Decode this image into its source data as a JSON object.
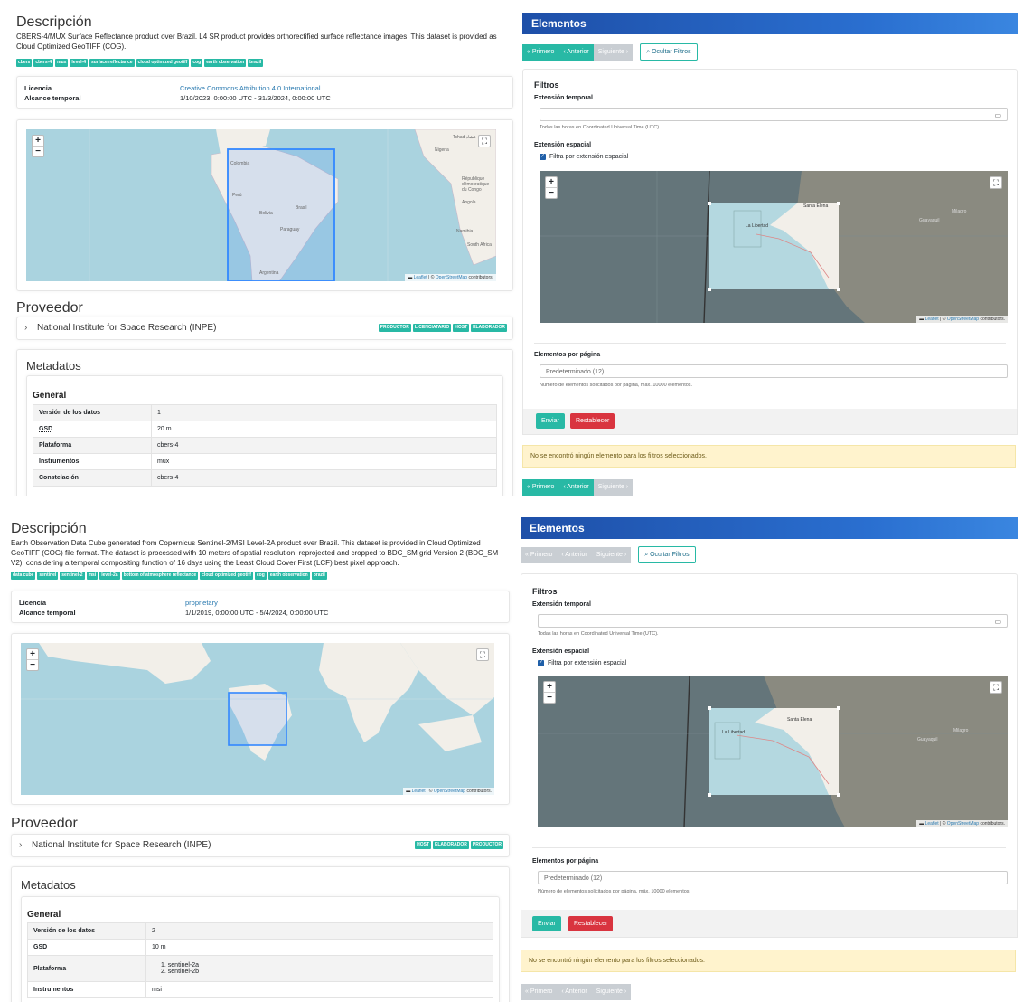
{
  "panel1": {
    "description": {
      "title": "Descripción",
      "text": "CBERS-4/MUX Surface Reflectance product over Brazil. L4 SR product provides orthorectified surface reflectance images. This dataset is provided as Cloud Optimized GeoTIFF (COG).",
      "keywords": [
        "cbers",
        "cbers-4",
        "mux",
        "level-4",
        "surface reflectance",
        "cloud optimized geotiff",
        "cog",
        "earth observation",
        "brazil"
      ]
    },
    "license_label": "Licencia",
    "license_value": "Creative Commons Attribution 4.0 International",
    "temporal_label": "Alcance temporal",
    "temporal_value": "1/10/2023, 0:00:00 UTC - 31/3/2024, 0:00:00 UTC",
    "map_attribution_leaflet": "Leaflet",
    "map_attribution_osm": "OpenStreetMap",
    "map_attribution_rest": "contributors.",
    "provider_title": "Proveedor",
    "provider_name": "National Institute for Space Research (INPE)",
    "provider_roles": [
      "PRODUCTOR",
      "LICENCIATARIO",
      "HOST",
      "ELABORADOR"
    ],
    "metadata_title": "Metadatos",
    "general_title": "General",
    "metadata_rows": [
      {
        "k": "Versión de los datos",
        "v": "1"
      },
      {
        "k": "GSD",
        "v": "20 m"
      },
      {
        "k": "Plataforma",
        "v": "cbers-4"
      },
      {
        "k": "Instrumentos",
        "v": "mux"
      },
      {
        "k": "Constelación",
        "v": "cbers-4"
      }
    ],
    "elements": {
      "title": "Elementos",
      "first": "« Primero",
      "prev": "‹ Anterior",
      "next": "Siguiente ›",
      "hide_filters": "Ocultar Filtros",
      "filters_title": "Filtros",
      "temporal_label": "Extensión temporal",
      "temporal_hint": "Todas las horas en Coordinated Universal Time (UTC).",
      "spatial_label": "Extensión espacial",
      "spatial_checkbox": "Filtra por extensión espacial",
      "per_page_label": "Elementos por página",
      "per_page_placeholder": "Predeterminado (12)",
      "per_page_hint": "Número de elementos solicitados por página, máx. 10000 elementos.",
      "submit": "Enviar",
      "reset": "Restablecer",
      "no_results": "No se encontró ningún elemento para los filtros seleccionados."
    }
  },
  "panel2": {
    "description": {
      "title": "Descripción",
      "text": "Earth Observation Data Cube generated from Copernicus Sentinel-2/MSI Level-2A product over Brazil. This dataset is provided in Cloud Optimized GeoTIFF (COG) file format. The dataset is processed with 10 meters of spatial resolution, reprojected and cropped to BDC_SM grid Version 2 (BDC_SM V2), considering a temporal compositing function of 16 days using the Least Cloud Cover First (LCF) best pixel approach.",
      "keywords": [
        "data cube",
        "sentinel",
        "sentinel-2",
        "msi",
        "level-2a",
        "bottom of atmosphere reflectance",
        "cloud optimized geotiff",
        "cog",
        "earth observation",
        "brazil"
      ]
    },
    "license_label": "Licencia",
    "license_value": "proprietary",
    "temporal_label": "Alcance temporal",
    "temporal_value": "1/1/2019, 0:00:00 UTC - 5/4/2024, 0:00:00 UTC",
    "map_attribution_leaflet": "Leaflet",
    "map_attribution_osm": "OpenStreetMap",
    "map_attribution_rest": "contributors.",
    "provider_title": "Proveedor",
    "provider_name": "National Institute for Space Research (INPE)",
    "provider_roles": [
      "HOST",
      "ELABORADOR",
      "PRODUCTOR"
    ],
    "metadata_title": "Metadatos",
    "general_title": "General",
    "metadata_rows": [
      {
        "k": "Versión de los datos",
        "v": "2"
      },
      {
        "k": "GSD",
        "v": "10 m"
      },
      {
        "k": "Plataforma",
        "v": "1. sentinel-2a\n2. sentinel-2b"
      },
      {
        "k": "Instrumentos",
        "v": "msi"
      }
    ],
    "elements": {
      "title": "Elementos",
      "first": "« Primero",
      "prev": "‹ Anterior",
      "next": "Siguiente ›",
      "hide_filters": "Ocultar Filtros",
      "filters_title": "Filtros",
      "temporal_label": "Extensión temporal",
      "temporal_hint": "Todas las horas en Coordinated Universal Time (UTC).",
      "spatial_label": "Extensión espacial",
      "spatial_checkbox": "Filtra por extensión espacial",
      "per_page_label": "Elementos por página",
      "per_page_placeholder": "Predeterminado (12)",
      "per_page_hint": "Número de elementos solicitados por página, máx. 10000 elementos.",
      "submit": "Enviar",
      "reset": "Restablecer",
      "no_results": "No se encontró ningún elemento para los filtros seleccionados."
    }
  },
  "map_labels": {
    "colombia": "Colombia",
    "peru": "Perú",
    "bolivia": "Bolivia",
    "brasil": "Brasil",
    "paraguay": "Paraguay",
    "argentina": "Argentina",
    "chad": "Tchad عشاد",
    "nigeria": "Nigeria",
    "rdc": "République démocratique du Congo",
    "angola": "Angola",
    "namibia": "Namibia",
    "south_africa": "South Africa",
    "la_libertad": "La Libertad",
    "santa_elena": "Santa Elena",
    "milagro": "Milagro",
    "guayaquil": "Guayaquil"
  },
  "colors": {
    "accent": "#28b9a5",
    "header_blue": "#1e4fa8",
    "danger": "#d9343f",
    "map_water": "#aad3df",
    "map_land": "#f2efe9",
    "bbox": "#3388ff"
  }
}
